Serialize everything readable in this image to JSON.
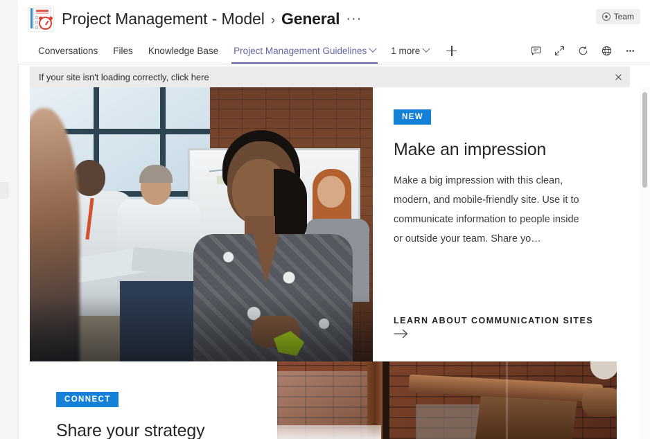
{
  "header": {
    "team_icon_name": "project-clipboard-clock-icon",
    "team_name": "Project Management - Model",
    "separator": "›",
    "channel_name": "General",
    "more_options": "···",
    "team_badge": {
      "icon": "eye-icon",
      "label": "Team"
    }
  },
  "tabbar": {
    "tabs": [
      {
        "label": "Conversations",
        "active": false,
        "has_caret": false
      },
      {
        "label": "Files",
        "active": false,
        "has_caret": false
      },
      {
        "label": "Knowledge Base",
        "active": false,
        "has_caret": false
      },
      {
        "label": "Project Management Guidelines",
        "active": true,
        "has_caret": true
      },
      {
        "label": "1 more",
        "active": false,
        "has_caret": true
      }
    ],
    "add_tab_icon": "plus-icon",
    "actions": [
      {
        "name": "conversation-icon",
        "title": "Conversation"
      },
      {
        "name": "expand-icon",
        "title": "Expand"
      },
      {
        "name": "refresh-icon",
        "title": "Refresh"
      },
      {
        "name": "globe-icon",
        "title": "Open in browser"
      },
      {
        "name": "more-icon",
        "title": "More options"
      }
    ],
    "accent_color": "#6264a7"
  },
  "notification": {
    "message": "If your site isn't loading correctly, click here",
    "close_icon": "close-icon",
    "background": "#ebebeb"
  },
  "page": {
    "hero": {
      "image_alt": "Woman in patterned blouse at office meeting with colleagues and brick wall",
      "badge": "NEW",
      "badge_color": "#1480d8",
      "heading": "Make an impression",
      "body": "Make a big impression with this clean, modern, and mobile-friendly site. Use it to communicate information to people inside or outside your team. Share yo…",
      "link_text": "LEARN ABOUT COMMUNICATION SITES",
      "link_arrow": "→"
    },
    "section2": {
      "badge": "CONNECT",
      "badge_color": "#1480d8",
      "heading": "Share your strategy",
      "image_alt": "Industrial brick wall with exposed duct work and windows"
    }
  },
  "scrollbar": {
    "name": "vertical-scrollbar",
    "thumb_color": "#c0c0c0"
  }
}
